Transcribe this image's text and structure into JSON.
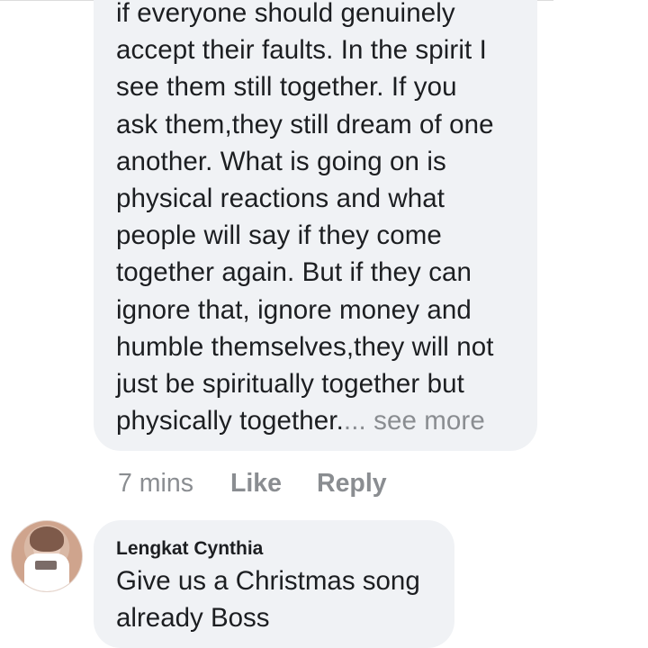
{
  "comment1": {
    "lines": [
      "if everyone should genuinely",
      "accept their faults. In the spirit I",
      "see them still together. If you",
      "ask them,they still dream of one",
      "another. What is going on is",
      "physical reactions and what",
      "people will say if they come",
      "together again. But if they can",
      "ignore that, ignore money and",
      "humble themselves,they will not",
      "just be spiritually together but",
      "physically together."
    ],
    "see_more": "... see more",
    "time": "7 mins",
    "like_label": "Like",
    "reply_label": "Reply"
  },
  "comment2": {
    "author": "Lengkat Cynthia",
    "lines": [
      "Give us a Christmas song",
      "already Boss"
    ]
  },
  "colors": {
    "bubble": "#f0f2f5",
    "text": "#1c1e21",
    "muted": "#8a8d91"
  }
}
